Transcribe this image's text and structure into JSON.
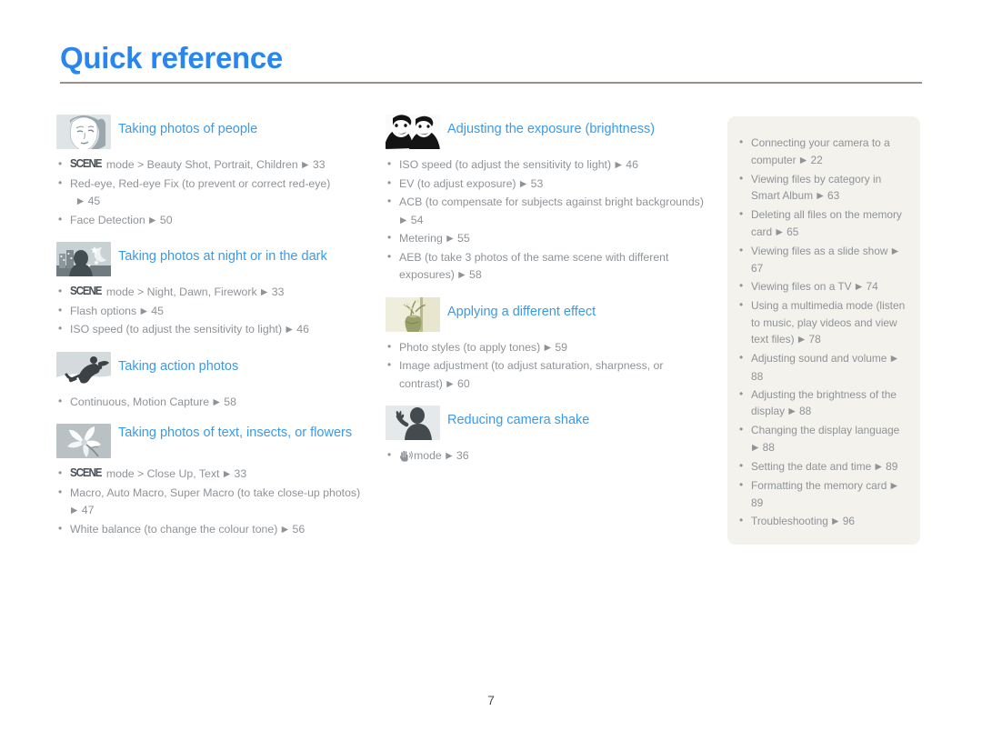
{
  "page": {
    "title": "Quick reference",
    "folio": "7",
    "accent_color": "#2986ef",
    "link_color": "#3b9ae8",
    "body_color": "#8e9398",
    "rule_color": "#9a8f8a",
    "sidebar_bg": "#f4f2ec"
  },
  "left_column": [
    {
      "icon": "portrait-face-photo-icon",
      "title": "Taking photos of people",
      "items": [
        {
          "pre_badge": "SCENE",
          "text": " mode > Beauty Shot, Portrait, Children",
          "arrow": "▶",
          "page": "33"
        },
        {
          "text": "Red-eye, Red-eye Fix (to prevent or correct red-eye)",
          "arrow": "▶",
          "page": "45",
          "wrap_page": true
        },
        {
          "text": "Face Detection",
          "arrow": "▶",
          "page": "50"
        }
      ]
    },
    {
      "icon": "night-scene-photo-icon",
      "title": "Taking photos at night or in the dark",
      "items": [
        {
          "pre_badge": "SCENE",
          "text": " mode > Night, Dawn, Firework",
          "arrow": "▶",
          "page": "33"
        },
        {
          "text": "Flash options",
          "arrow": "▶",
          "page": "45"
        },
        {
          "text": "ISO speed (to adjust the sensitivity to light)",
          "arrow": "▶",
          "page": "46"
        }
      ]
    },
    {
      "icon": "snowboarder-action-photo-icon",
      "title": "Taking action photos",
      "items": [
        {
          "text": "Continuous, Motion Capture",
          "arrow": "▶",
          "page": "58"
        }
      ]
    },
    {
      "icon": "flower-macro-photo-icon",
      "title": "Taking photos of text, insects, or flowers",
      "two_line": true,
      "items": [
        {
          "pre_badge": "SCENE",
          "text": " mode > Close Up, Text",
          "arrow": "▶",
          "page": "33"
        },
        {
          "text": "Macro, Auto Macro, Super Macro (to take close-up photos)",
          "arrow": "▶",
          "page": "47"
        },
        {
          "text": "White balance (to change the colour tone)",
          "arrow": "▶",
          "page": "56"
        }
      ]
    }
  ],
  "middle_column": [
    {
      "icon": "two-faces-exposure-photo-icon",
      "title": "Adjusting the exposure (brightness)",
      "items": [
        {
          "text": "ISO speed (to adjust the sensitivity to light)",
          "arrow": "▶",
          "page": "46"
        },
        {
          "text": "EV (to adjust exposure)",
          "arrow": "▶",
          "page": "53"
        },
        {
          "text": "ACB (to compensate for subjects against bright backgrounds)",
          "arrow": "▶",
          "page": "54"
        },
        {
          "text": "Metering",
          "arrow": "▶",
          "page": "55"
        },
        {
          "text": "AEB (to take 3 photos of the same scene with different exposures)",
          "arrow": "▶",
          "page": "58"
        }
      ]
    },
    {
      "icon": "vase-flowers-effect-photo-icon",
      "title": "Applying a different effect",
      "items": [
        {
          "text": "Photo styles (to apply tones)",
          "arrow": "▶",
          "page": "59"
        },
        {
          "text": "Image adjustment (to adjust saturation, sharpness, or contrast)",
          "arrow": "▶",
          "page": "60"
        }
      ]
    },
    {
      "icon": "person-waving-shake-photo-icon",
      "title": "Reducing camera shake",
      "items": [
        {
          "pre_icon": "hand-shake-mode-icon",
          "text": "mode",
          "arrow": "▶",
          "page": "36"
        }
      ]
    }
  ],
  "right_column": {
    "items": [
      {
        "text": "Connecting your camera to a computer",
        "arrow": "▶",
        "page": "22"
      },
      {
        "text": "Viewing files by category in Smart Album",
        "arrow": "▶",
        "page": "63"
      },
      {
        "text": "Deleting all files on the memory card",
        "arrow": "▶",
        "page": "65"
      },
      {
        "text": "Viewing files as a slide show",
        "arrow": "▶",
        "page": "67"
      },
      {
        "text": "Viewing files on a TV",
        "arrow": "▶",
        "page": "74"
      },
      {
        "text": "Using a multimedia mode (listen to music, play videos and view text files)",
        "arrow": "▶",
        "page": "78"
      },
      {
        "text": "Adjusting sound and volume",
        "arrow": "▶",
        "page": "88"
      },
      {
        "text": "Adjusting the brightness of the display",
        "arrow": "▶",
        "page": "88"
      },
      {
        "text": "Changing the display language",
        "arrow": "▶",
        "page": "88"
      },
      {
        "text": "Setting the date and time",
        "arrow": "▶",
        "page": "89"
      },
      {
        "text": "Formatting the memory card",
        "arrow": "▶",
        "page": "89"
      },
      {
        "text": "Troubleshooting",
        "arrow": "▶",
        "page": "96"
      }
    ]
  }
}
